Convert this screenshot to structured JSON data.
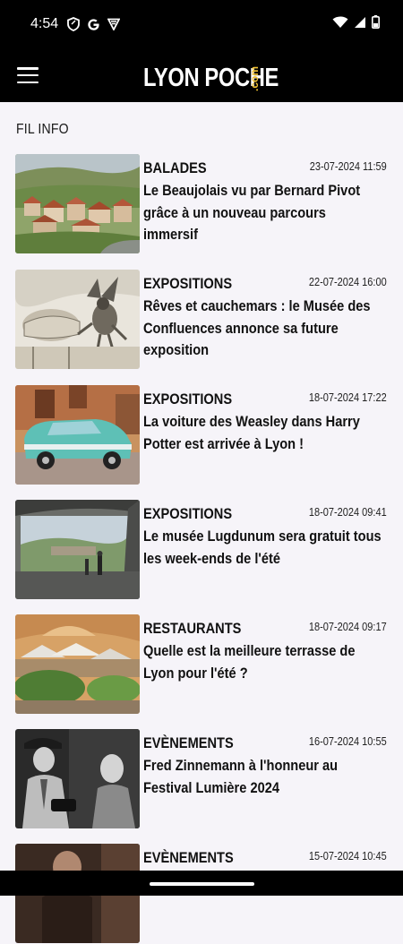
{
  "status_bar": {
    "time": "4:54",
    "left_icons": [
      "shield-icon",
      "google-icon",
      "vpn-icon"
    ],
    "right_icons": [
      "wifi-icon",
      "signal-icon",
      "battery-icon"
    ]
  },
  "app_bar": {
    "logo_main": "LYON POCHE",
    "logo_suffix": ".com",
    "menu_icon": "hamburger-menu-icon"
  },
  "section_title": "FIL INFO",
  "articles": [
    {
      "category": "BALADES",
      "date": "23-07-2024 11:59",
      "title": "Le Beaujolais vu par Bernard Pivot grâce à un nouveau parcours immersif",
      "image": "beaujolais-village-photo"
    },
    {
      "category": "EXPOSITIONS",
      "date": "22-07-2024 16:00",
      "title": "Rêves et cauchemars : le Musée des Confluences annonce sa future exposition",
      "image": "nightmare-engraving-photo"
    },
    {
      "category": "EXPOSITIONS",
      "date": "18-07-2024 17:22",
      "title": "La voiture des Weasley dans Harry Potter est arrivée à Lyon !",
      "image": "turquoise-car-photo"
    },
    {
      "category": "EXPOSITIONS",
      "date": "18-07-2024 09:41",
      "title": "Le musée Lugdunum sera gratuit tous les week-ends de l'été",
      "image": "lugdunum-museum-photo"
    },
    {
      "category": "RESTAURANTS",
      "date": "18-07-2024 09:17",
      "title": "Quelle est la meilleure terrasse de Lyon pour l'été ?",
      "image": "terrace-photo"
    },
    {
      "category": "EVÈNEMENTS",
      "date": "16-07-2024 10:55",
      "title": "Fred Zinnemann à l'honneur au Festival Lumière 2024",
      "image": "black-white-film-photo"
    },
    {
      "category": "EVÈNEMENTS",
      "date": "15-07-2024 10:45",
      "title": "",
      "image": "partial-event-photo"
    }
  ]
}
